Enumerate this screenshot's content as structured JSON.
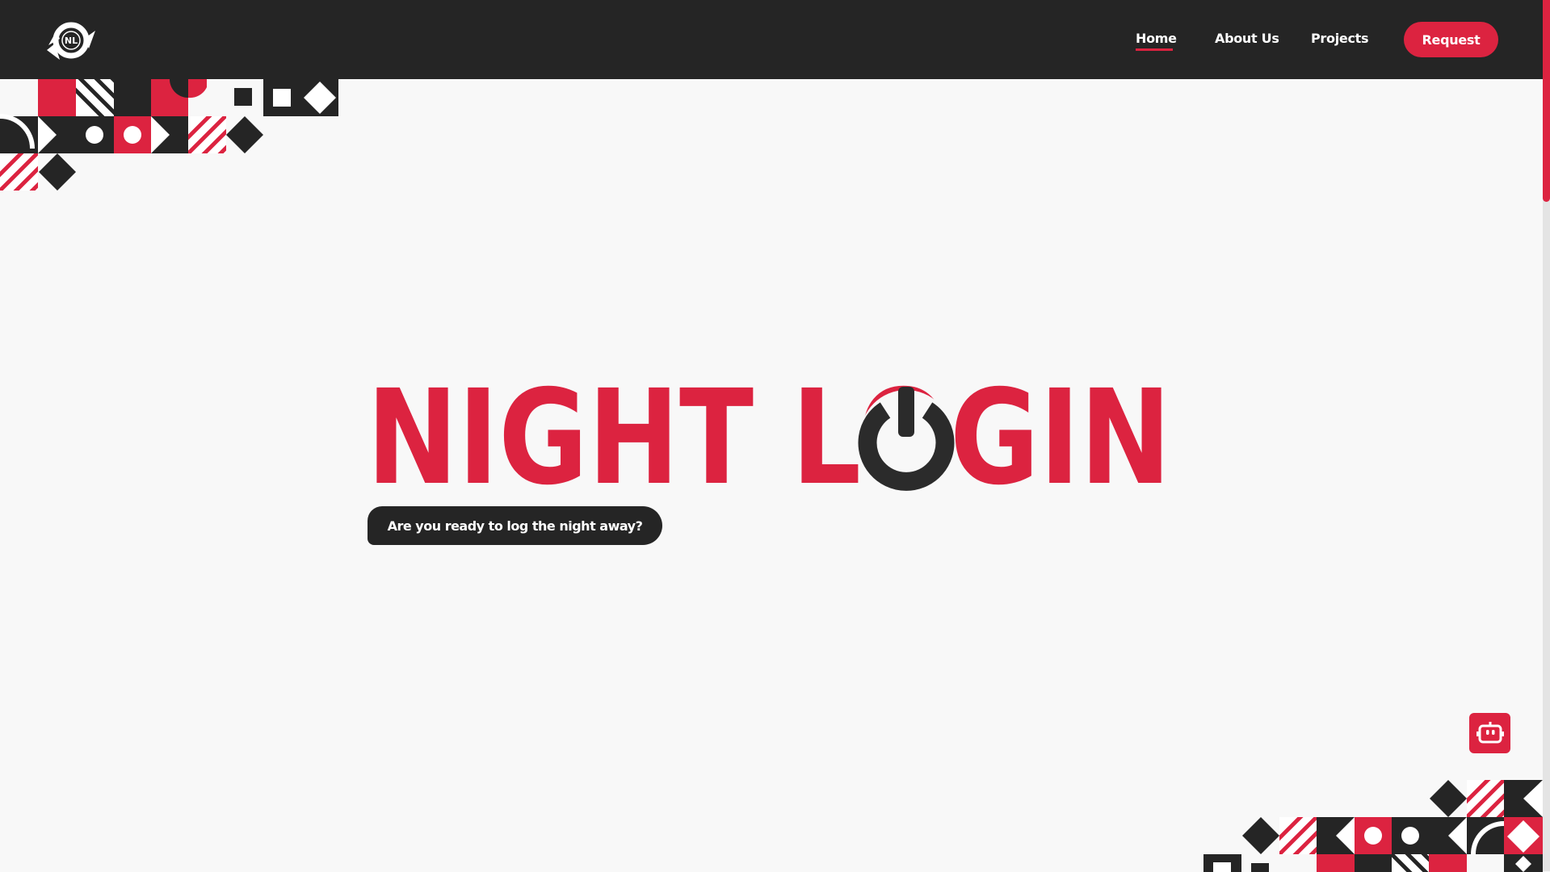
{
  "nav": {
    "logo_text": "NL",
    "links": [
      "Home",
      "About Us",
      "Projects"
    ],
    "active": "Home",
    "request_label": "Request"
  },
  "hero": {
    "title": "NIGHT LOGIN",
    "tagline": "Are you ready to log the night away?"
  },
  "chatbot": {
    "icon": "robot-icon"
  },
  "colors": {
    "accent": "#dc2340",
    "dark": "#252525",
    "background": "#f8f8f8"
  }
}
